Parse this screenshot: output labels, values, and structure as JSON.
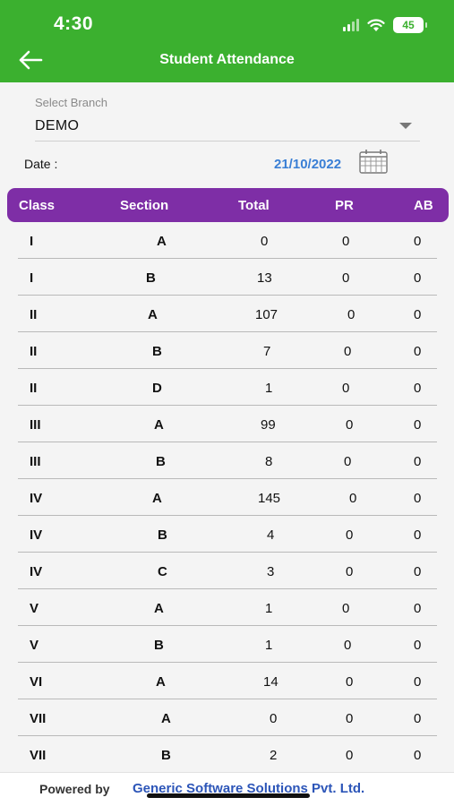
{
  "status_bar": {
    "time": "4:30",
    "battery": "45",
    "icons": [
      "signal-icon",
      "wifi-icon",
      "battery-icon"
    ]
  },
  "app_bar": {
    "title": "Student Attendance",
    "back_icon": "back-arrow-icon"
  },
  "branch": {
    "label": "Select Branch",
    "value": "DEMO"
  },
  "date": {
    "label": "Date :",
    "value": "21/10/2022",
    "icon": "calendar-icon"
  },
  "table": {
    "headers": {
      "class": "Class",
      "section": "Section",
      "total": "Total",
      "pr": "PR",
      "ab": "AB"
    },
    "rows": [
      {
        "class": "I",
        "section": "A",
        "total": "0",
        "pr": "0",
        "ab": "0"
      },
      {
        "class": "I",
        "section": "B",
        "total": "13",
        "pr": "0",
        "ab": "0"
      },
      {
        "class": "II",
        "section": "A",
        "total": "107",
        "pr": "0",
        "ab": "0"
      },
      {
        "class": "II",
        "section": "B",
        "total": "7",
        "pr": "0",
        "ab": "0"
      },
      {
        "class": "II",
        "section": "D",
        "total": "1",
        "pr": "0",
        "ab": "0"
      },
      {
        "class": "III",
        "section": "A",
        "total": "99",
        "pr": "0",
        "ab": "0"
      },
      {
        "class": "III",
        "section": "B",
        "total": "8",
        "pr": "0",
        "ab": "0"
      },
      {
        "class": "IV",
        "section": "A",
        "total": "145",
        "pr": "0",
        "ab": "0"
      },
      {
        "class": "IV",
        "section": "B",
        "total": "4",
        "pr": "0",
        "ab": "0"
      },
      {
        "class": "IV",
        "section": "C",
        "total": "3",
        "pr": "0",
        "ab": "0"
      },
      {
        "class": "V",
        "section": "A",
        "total": "1",
        "pr": "0",
        "ab": "0"
      },
      {
        "class": "V",
        "section": "B",
        "total": "1",
        "pr": "0",
        "ab": "0"
      },
      {
        "class": "VI",
        "section": "A",
        "total": "14",
        "pr": "0",
        "ab": "0"
      },
      {
        "class": "VII",
        "section": "A",
        "total": "0",
        "pr": "0",
        "ab": "0"
      },
      {
        "class": "VII",
        "section": "B",
        "total": "2",
        "pr": "0",
        "ab": "0"
      }
    ]
  },
  "footer": {
    "prefix": "Powered by",
    "company": "Generic Software Solutions Pvt. Ltd."
  },
  "colors": {
    "app_bar": "#3bb02f",
    "table_header": "#7e2ea6",
    "date": "#3a7fd5",
    "footer_link": "#2c55b8"
  }
}
